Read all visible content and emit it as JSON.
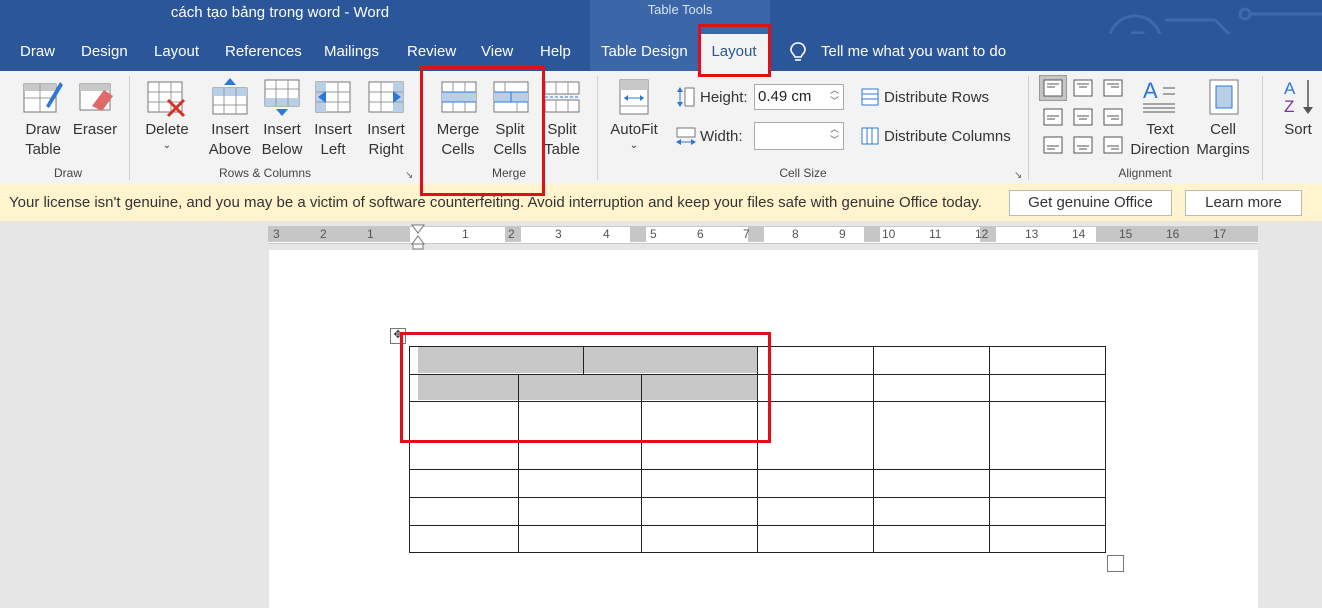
{
  "window": {
    "title": "cách tạo bảng trong word  -  Word",
    "context_title": "Table Tools"
  },
  "tabs": {
    "draw": "Draw",
    "design": "Design",
    "layout": "Layout",
    "references": "References",
    "mailings": "Mailings",
    "review": "Review",
    "view": "View",
    "help": "Help",
    "table_design": "Table Design",
    "table_layout": "Layout",
    "tell_me": "Tell me what you want to do"
  },
  "ribbon": {
    "draw_table": [
      "Draw",
      "Table"
    ],
    "eraser": "Eraser",
    "delete": "Delete",
    "insert_above": [
      "Insert",
      "Above"
    ],
    "insert_below": [
      "Insert",
      "Below"
    ],
    "insert_left": [
      "Insert",
      "Left"
    ],
    "insert_right": [
      "Insert",
      "Right"
    ],
    "merge_cells": [
      "Merge",
      "Cells"
    ],
    "split_cells": [
      "Split",
      "Cells"
    ],
    "split_table": [
      "Split",
      "Table"
    ],
    "autofit": "AutoFit",
    "height_label": "Height:",
    "height_value": "0.49 cm",
    "width_label": "Width:",
    "width_value": "",
    "distribute_rows": "Distribute Rows",
    "distribute_columns": "Distribute Columns",
    "text_direction": [
      "Text",
      "Direction"
    ],
    "cell_margins": [
      "Cell",
      "Margins"
    ],
    "sort": "Sort",
    "groups": {
      "draw": "Draw",
      "rows_columns": "Rows & Columns",
      "merge": "Merge",
      "cell_size": "Cell Size",
      "alignment": "Alignment"
    }
  },
  "infobar": {
    "message": "Your license isn't genuine, and you may be a victim of software counterfeiting. Avoid interruption and keep your files safe with genuine Office today.",
    "get_genuine": "Get genuine Office",
    "learn_more": "Learn more"
  },
  "ruler": {
    "left_numbers": [
      "3",
      "2",
      "1"
    ],
    "right_numbers": [
      "1",
      "2",
      "3",
      "4",
      "5",
      "6",
      "7",
      "8",
      "9",
      "10",
      "11",
      "12",
      "13",
      "14",
      "15",
      "16",
      "17"
    ]
  },
  "colors": {
    "titlebar": "#2b579a",
    "context_tab": "#3b66a8",
    "highlight": "#e0101b",
    "selected_cell": "#c8c8c8",
    "infobar": "#fff4ce"
  },
  "table": {
    "rows": 7,
    "selected_cells": 5
  }
}
